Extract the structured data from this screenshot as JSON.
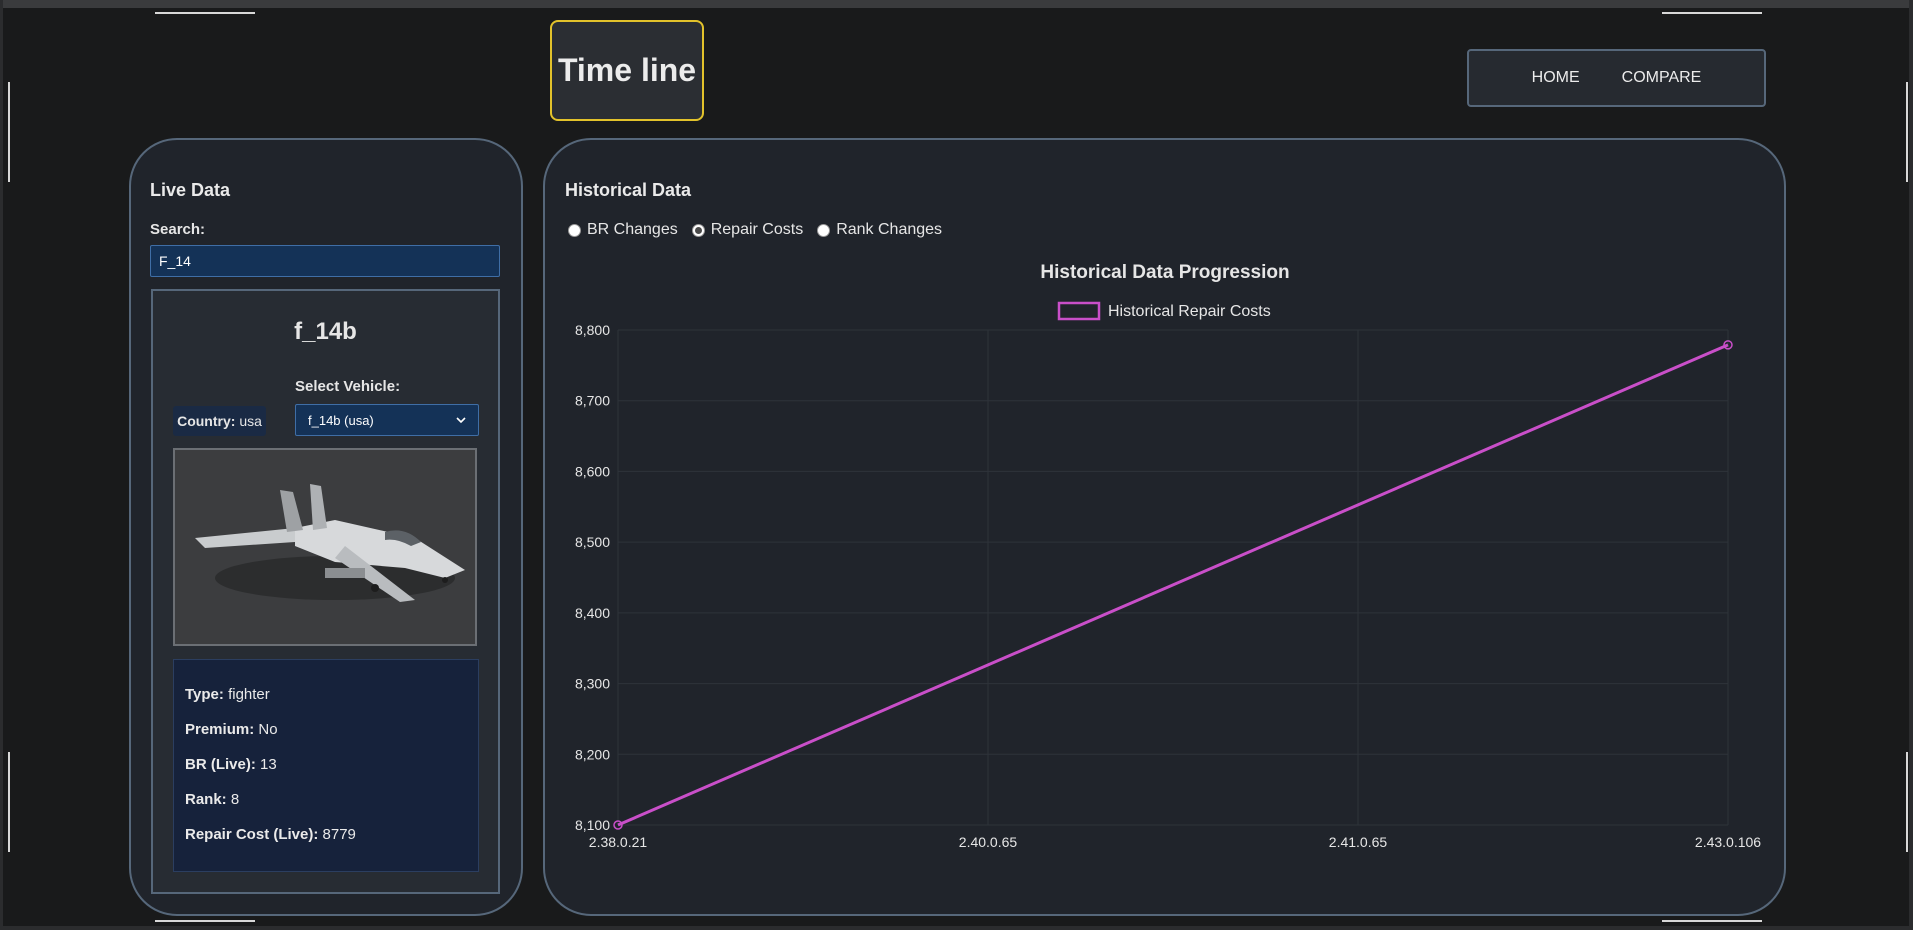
{
  "header": {
    "title": "Time line"
  },
  "nav": {
    "home": "HOME",
    "compare": "COMPARE"
  },
  "live": {
    "title": "Live Data",
    "search_label": "Search:",
    "search_value": "F_14",
    "vehicle_name": "f_14b",
    "country_label": "Country:",
    "country_value": "usa",
    "select_label": "Select Vehicle:",
    "select_value": "f_14b (usa)",
    "stats": [
      {
        "label": "Type:",
        "value": "fighter"
      },
      {
        "label": "Premium:",
        "value": "No"
      },
      {
        "label": "BR (Live):",
        "value": "13"
      },
      {
        "label": "Rank:",
        "value": "8"
      },
      {
        "label": "Repair Cost (Live):",
        "value": "8779"
      }
    ]
  },
  "historical": {
    "title": "Historical Data",
    "options": [
      {
        "label": "BR Changes",
        "checked": false
      },
      {
        "label": "Repair Costs",
        "checked": true
      },
      {
        "label": "Rank Changes",
        "checked": false
      }
    ]
  },
  "chart_data": {
    "type": "line",
    "title": "Historical Data Progression",
    "x": [
      "2.38.0.21",
      "2.40.0.65",
      "2.41.0.65",
      "2.43.0.106"
    ],
    "series": [
      {
        "name": "Historical Repair Costs",
        "points": [
          {
            "x": "2.38.0.21",
            "y": 8100
          },
          {
            "x": "2.43.0.106",
            "y": 8779
          }
        ],
        "color": "#c94fc9"
      }
    ],
    "yticks": [
      "8,100",
      "8,200",
      "8,300",
      "8,400",
      "8,500",
      "8,600",
      "8,700",
      "8,800"
    ],
    "ylim": [
      8100,
      8800
    ],
    "legend": "top",
    "grid": true
  }
}
